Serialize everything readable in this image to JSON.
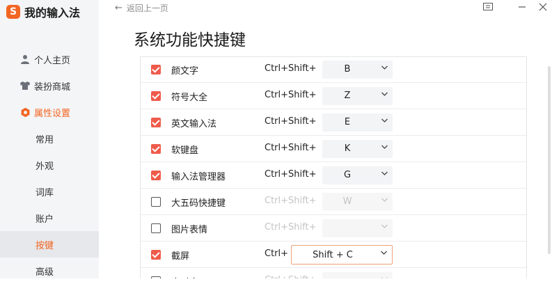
{
  "app": {
    "logo_letter": "S",
    "title": "我的输入法"
  },
  "nav": {
    "items": [
      {
        "label": "个人主页",
        "icon": "person-icon"
      },
      {
        "label": "装扮商城",
        "icon": "shirt-icon"
      },
      {
        "label": "属性设置",
        "icon": "settings-icon"
      }
    ],
    "sub": [
      "常用",
      "外观",
      "词库",
      "账户",
      "按键",
      "高级"
    ]
  },
  "topbar": {
    "back_label": "返回上一页"
  },
  "page": {
    "title": "系统功能快捷键"
  },
  "shortcuts": [
    {
      "name": "颜文字",
      "checked": true,
      "modifier": "Ctrl+Shift+",
      "key": "B"
    },
    {
      "name": "符号大全",
      "checked": true,
      "modifier": "Ctrl+Shift+",
      "key": "Z"
    },
    {
      "name": "英文输入法",
      "checked": true,
      "modifier": "Ctrl+Shift+",
      "key": "E"
    },
    {
      "name": "软键盘",
      "checked": true,
      "modifier": "Ctrl+Shift+",
      "key": "K"
    },
    {
      "name": "输入法管理器",
      "checked": true,
      "modifier": "Ctrl+Shift+",
      "key": "G"
    },
    {
      "name": "大五码快捷键",
      "checked": false,
      "modifier": "Ctrl+Shift+",
      "key": "W"
    },
    {
      "name": "图片表情",
      "checked": false,
      "modifier": "Ctrl+Shift+",
      "key": ""
    },
    {
      "name": "截屏",
      "checked": true,
      "modifier": "Ctrl+",
      "key": "Shift + C"
    },
    {
      "name": "中时命了",
      "checked": false,
      "modifier": "Ctrl+Shift+",
      "key": ""
    }
  ],
  "colors": {
    "accent": "#f26522",
    "checkbox": "#ef5b4b",
    "sidebar_bg": "#f4f5f7"
  }
}
